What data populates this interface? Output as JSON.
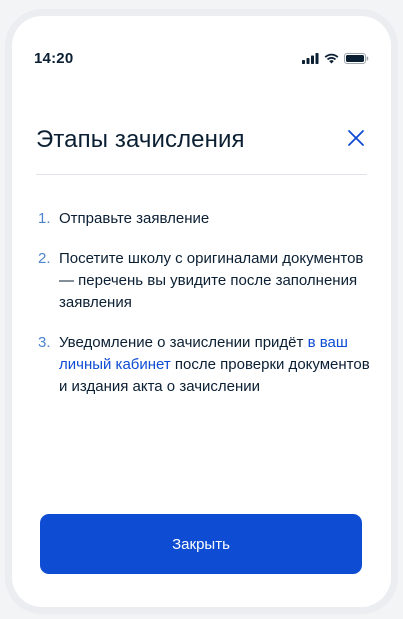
{
  "status_bar": {
    "time": "14:20",
    "icons": [
      "signal-icon",
      "wifi-icon",
      "battery-icon"
    ]
  },
  "modal": {
    "title": "Этапы зачисления",
    "close_icon": "close-icon",
    "steps": [
      {
        "number": "1.",
        "text": "Отправьте заявление"
      },
      {
        "number": "2.",
        "text": "Посетите школу с оригиналами документов — перечень вы увидите после заполнения заявления"
      },
      {
        "number": "3.",
        "text_before": "Уведомление о зачислении придёт ",
        "link": "в ваш личный кабинет",
        "text_after": " после проверки документов и издания акта о зачислении"
      }
    ],
    "button_label": "Закрыть"
  },
  "colors": {
    "accent": "#0d4cd3",
    "step_number": "#4c84cf",
    "text": "#0b1f33",
    "divider": "#dfe3e8"
  }
}
